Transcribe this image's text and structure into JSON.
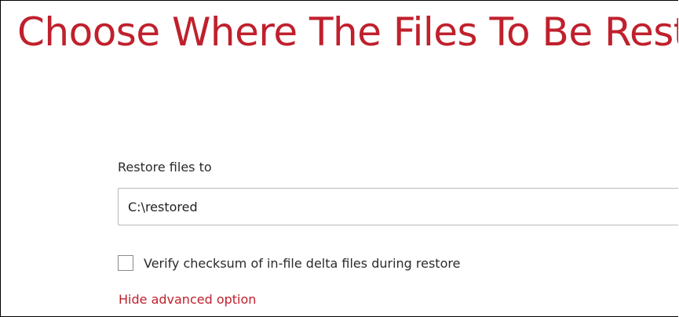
{
  "page": {
    "title": "Choose Where The Files To Be Restored",
    "accent_color": "#c0202d"
  },
  "restore_destination": {
    "label": "Restore files to",
    "value": "C:\\restored"
  },
  "options": {
    "verify_checksum_label": "Verify checksum of in-file delta files during restore",
    "verify_checksum_checked": false,
    "advanced_toggle_label": "Hide advanced option"
  }
}
